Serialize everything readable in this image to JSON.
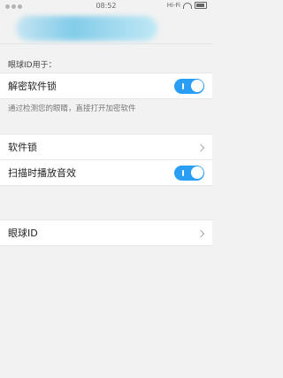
{
  "status_bar": {
    "time": "08:52",
    "network": "Hi-Fi"
  },
  "header": {
    "logo": "blurred-logo"
  },
  "section": {
    "label": "眼球ID用于："
  },
  "settings": {
    "unlock_apps": {
      "label": "解密软件锁",
      "enabled": true
    },
    "unlock_desc": "通过检测您的眼睛，直接打开加密软件",
    "app_lock": {
      "label": "软件锁"
    },
    "scan_sound": {
      "label": "扫描时播放音效",
      "enabled": true
    },
    "eye_id": {
      "label": "眼球ID"
    }
  },
  "colors": {
    "accent": "#2a9df4",
    "background": "#f2f2f2"
  }
}
